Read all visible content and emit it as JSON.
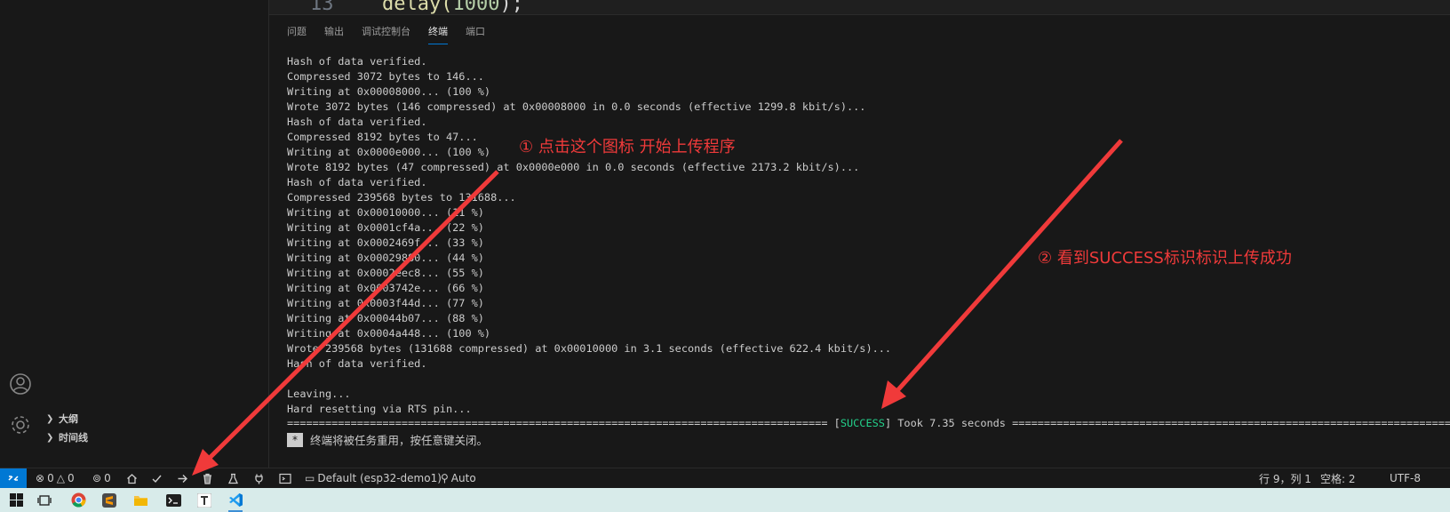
{
  "editor": {
    "line_number": "13",
    "code_fn": "delay(",
    "code_num": "1000",
    "code_tail": ");"
  },
  "sidebar": {
    "sections": [
      {
        "label": "大纲"
      },
      {
        "label": "时间线"
      }
    ]
  },
  "panel": {
    "tabs": [
      "问题",
      "输出",
      "调试控制台",
      "终端",
      "端口"
    ],
    "active_tab": "终端"
  },
  "terminal": {
    "lines": [
      "Hash of data verified.",
      "Compressed 3072 bytes to 146...",
      "Writing at 0x00008000... (100 %)",
      "Wrote 3072 bytes (146 compressed) at 0x00008000 in 0.0 seconds (effective 1299.8 kbit/s)...",
      "Hash of data verified.",
      "Compressed 8192 bytes to 47...",
      "Writing at 0x0000e000... (100 %)",
      "Wrote 8192 bytes (47 compressed) at 0x0000e000 in 0.0 seconds (effective 2173.2 kbit/s)...",
      "Hash of data verified.",
      "Compressed 239568 bytes to 131688...",
      "Writing at 0x00010000... (11 %)",
      "Writing at 0x0001cf4a... (22 %)",
      "Writing at 0x0002469f... (33 %)",
      "Writing at 0x00029880... (44 %)",
      "Writing at 0x0002eec8... (55 %)",
      "Writing at 0x0003742e... (66 %)",
      "Writing at 0x0003f44d... (77 %)",
      "Writing at 0x00044b07... (88 %)",
      "Writing at 0x0004a448... (100 %)",
      "Wrote 239568 bytes (131688 compressed) at 0x00010000 in 3.1 seconds (effective 622.4 kbit/s)...",
      "Hash of data verified.",
      "",
      "Leaving...",
      "Hard resetting via RTS pin..."
    ],
    "separator_left": "===================================================================================== [",
    "success_word": "SUCCESS",
    "separator_right": "] Took 7.35 seconds ========================================================================================",
    "reuse_star": "*",
    "reuse_message": "终端将被任务重用，按任意键关闭。"
  },
  "annotations": {
    "step1": "① 点击这个图标 开始上传程序",
    "step2": "② 看到SUCCESS标识标识上传成功"
  },
  "statusbar": {
    "errors": "0",
    "warnings": "0",
    "ports": "0",
    "env": "Default (esp32-demo1)",
    "auto": "Auto",
    "position": "行 9，列 1",
    "spaces": "空格: 2",
    "encoding": "UTF-8"
  },
  "colors": {
    "accent": "#0078d4",
    "success": "#23d18b",
    "annotation": "#f03a3a",
    "taskbar": "#d8ebea"
  }
}
